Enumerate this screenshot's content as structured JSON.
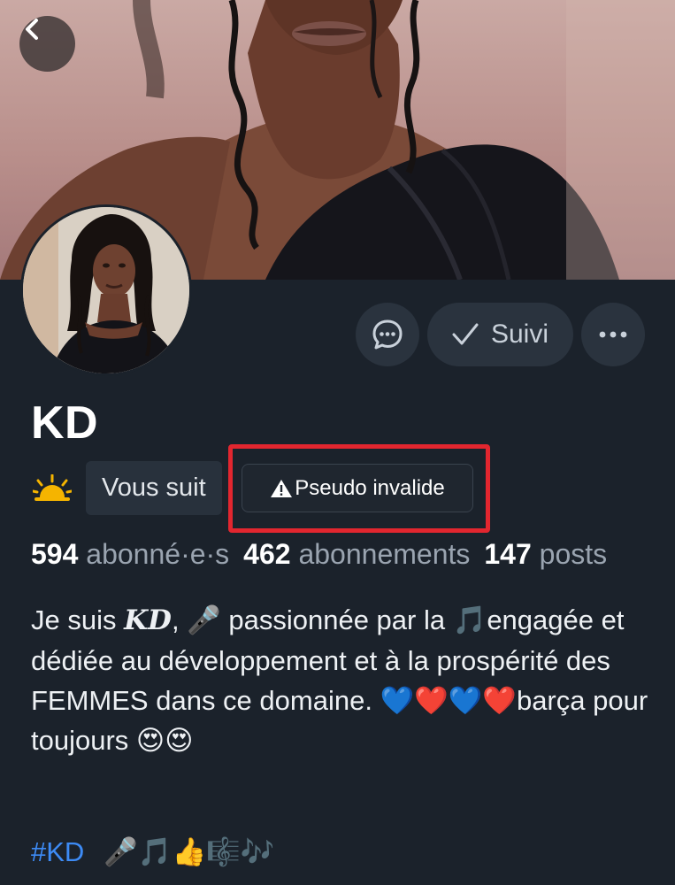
{
  "profile": {
    "display_name": "KD",
    "follows_you_label": "Vous suit",
    "handle_status": "Pseudo invalide",
    "warning_glyph": "⚠",
    "header_emoji": "🌤"
  },
  "actions": {
    "follow_label": "Suivi",
    "follow_check": "✓"
  },
  "stats": {
    "followers_count": "594",
    "followers_label": "abonné·e·s",
    "following_count": "462",
    "following_label": "abonnements",
    "posts_count": "147",
    "posts_label": "posts"
  },
  "bio": {
    "prefix": "Je suis ",
    "kd": "KD",
    "rest": ", 🎤 passionnée par la 🎵engagée et dédiée au développement et à la prospérité des FEMMES dans ce domaine. 💙❤️💙❤️barça pour toujours 😍😍",
    "hashtag": "#KD",
    "emoji_tail": "🎤🎵👍🎼🎶"
  },
  "colors": {
    "background": "#1b222b",
    "button_bg": "#2a333e",
    "link": "#3d8bf5",
    "highlight": "#e2262f",
    "muted_text": "#9aa4b0"
  }
}
